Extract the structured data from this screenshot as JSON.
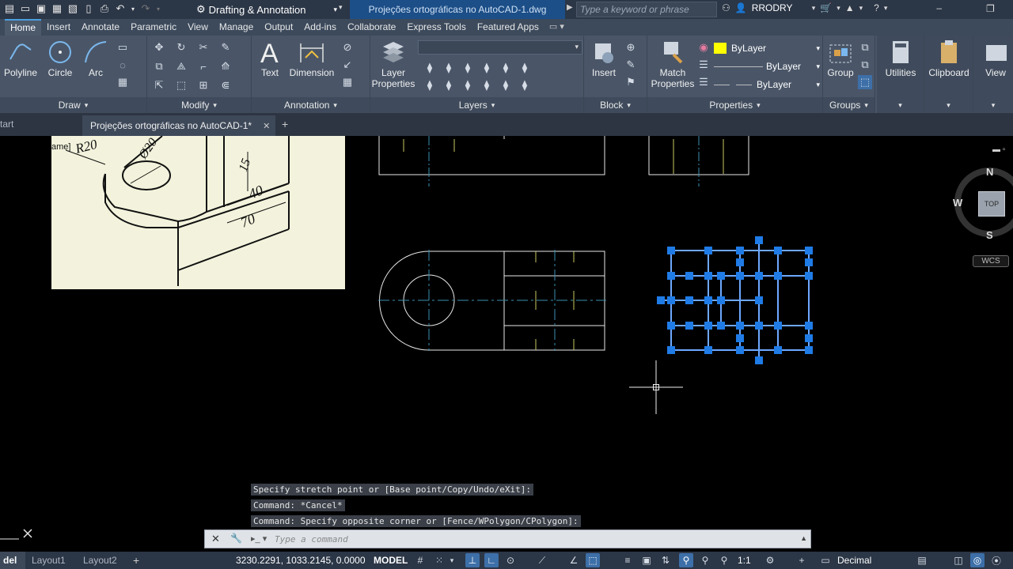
{
  "titlebar": {
    "workspace": "Drafting & Annotation",
    "document_title": "Projeções ortográficas no AutoCAD-1.dwg",
    "search_placeholder": "Type a keyword or phrase",
    "user": "RRODRY"
  },
  "ribbon": {
    "tabs": [
      "Home",
      "Insert",
      "Annotate",
      "Parametric",
      "View",
      "Manage",
      "Output",
      "Add-ins",
      "Collaborate",
      "Express Tools",
      "Featured Apps"
    ],
    "active_tab": "Home",
    "draw": {
      "title": "Draw",
      "polyline": "Polyline",
      "circle": "Circle",
      "arc": "Arc"
    },
    "modify": {
      "title": "Modify"
    },
    "annotation": {
      "title": "Annotation",
      "text": "Text",
      "dimension": "Dimension"
    },
    "layers": {
      "title": "Layers",
      "layer_properties": "Layer\nProperties"
    },
    "block": {
      "title": "Block",
      "insert": "Insert"
    },
    "properties": {
      "title": "Properties",
      "match_properties": "Match\nProperties",
      "color": "ByLayer",
      "linetype": "ByLayer",
      "lineweight": "ByLayer",
      "color_swatch": "#ffff00"
    },
    "groups": {
      "title": "Groups",
      "group": "Group"
    },
    "utilities": "Utilities",
    "clipboard": "Clipboard",
    "view": "View"
  },
  "doc_tabs": {
    "start": "tart",
    "file": "Projeções ortográficas no AutoCAD-1*"
  },
  "reference_image": {
    "labels": [
      "ame]",
      "R20",
      "Ø20",
      "15",
      "40",
      "70"
    ]
  },
  "viewcube": {
    "north": "N",
    "west": "W",
    "south": "S",
    "top": "TOP",
    "wcs": "WCS"
  },
  "command": {
    "history": [
      "Specify stretch point or [Base point/Copy/Undo/eXit]:",
      "Command: *Cancel*",
      "Command: Specify opposite corner or [Fence/WPolygon/CPolygon]:"
    ],
    "placeholder": "Type a command"
  },
  "statusbar": {
    "layout_tabs": [
      "del",
      "Layout1",
      "Layout2"
    ],
    "coordinates": "3230.2291, 1033.2145, 0.0000",
    "space": "MODEL",
    "scale": "1:1",
    "units": "Decimal"
  }
}
